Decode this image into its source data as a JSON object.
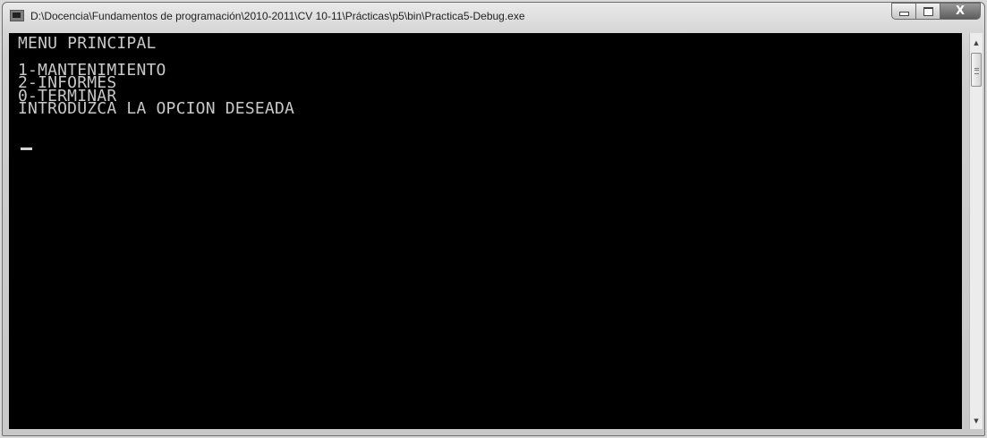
{
  "window": {
    "title": "D:\\Docencia\\Fundamentos de programación\\2010-2011\\CV 10-11\\Prácticas\\p5\\bin\\Practica5-Debug.exe",
    "icon": "console-app-icon",
    "buttons": {
      "minimize_icon": "minimize-icon",
      "maximize_icon": "maximize-icon",
      "close_label": "X"
    }
  },
  "console": {
    "lines": [
      "MENU PRINCIPAL",
      "",
      "1-MANTENIMIENTO",
      "2-INFORMES",
      "0-TERMINAR",
      "INTRODUZCA LA OPCION DESEADA"
    ],
    "cursor": "_"
  },
  "scrollbar": {
    "up_arrow": "▲",
    "down_arrow": "▼"
  },
  "colors": {
    "console_background": "#000000",
    "console_text": "#c8c8c8",
    "titlebar": "#d7d7d7",
    "close_button": "#6e6e6e"
  }
}
